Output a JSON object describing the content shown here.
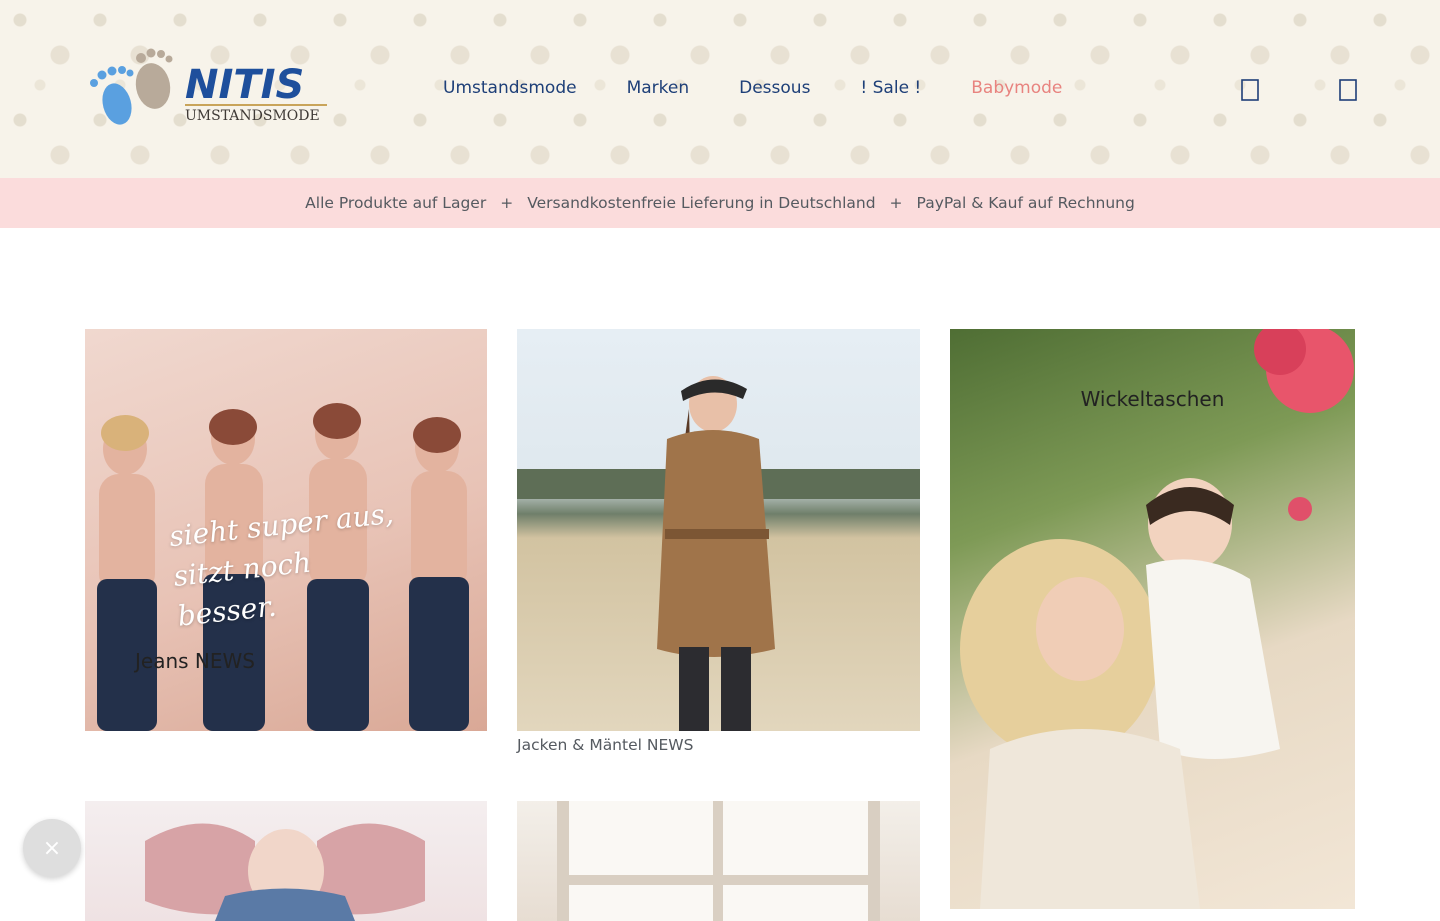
{
  "brand": {
    "name": "NITIS",
    "tagline": "UMSTANDSMODE"
  },
  "nav": {
    "items": [
      {
        "label": "Umstandsmode"
      },
      {
        "label": "Marken"
      },
      {
        "label": "Dessous"
      },
      {
        "label": "! Sale !"
      },
      {
        "label": "Babymode"
      }
    ],
    "accent_color": "#e8837f",
    "link_color": "#1e3f78"
  },
  "header_icons": {
    "search": "search-icon",
    "cart": "cart-icon"
  },
  "usp": {
    "items": [
      "Alle Produkte auf Lager",
      "Versandkostenfreie Lieferung in Deutschland",
      "PayPal & Kauf auf Rechnung"
    ],
    "separator": "+",
    "background": "#fbdcdc"
  },
  "tiles": [
    {
      "caption": "Jeans NEWS",
      "overlay_text": "sieht super aus, sitzt noch besser."
    },
    {
      "caption": "Jacken & Mäntel NEWS"
    },
    {
      "caption": "Wickeltaschen"
    }
  ],
  "close_button": {
    "label": "×"
  }
}
